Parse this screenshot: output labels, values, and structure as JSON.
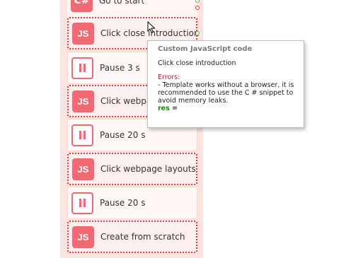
{
  "blocks": [
    {
      "type": "cs",
      "icon": "C#",
      "label": "Go to start"
    },
    {
      "type": "js",
      "icon": "JS",
      "label": "Click close introduction"
    },
    {
      "type": "pause",
      "label": "Pause 3 s"
    },
    {
      "type": "js",
      "icon": "JS",
      "label": "Click webpage layouts"
    },
    {
      "type": "pause",
      "label": "Pause 20 s"
    },
    {
      "type": "js",
      "icon": "JS",
      "label": "Click webpage layouts"
    },
    {
      "type": "pause",
      "label": "Pause 20 s"
    },
    {
      "type": "js",
      "icon": "JS",
      "label": "Create from scratch"
    }
  ],
  "tooltip": {
    "title": "Custom JavaScript code",
    "description": "Click close introduction",
    "errors_heading": "Errors:",
    "error_lines": [
      "- Template works without a browser, it is",
      "recommended to use the C # snippet to",
      "avoid memory leaks."
    ],
    "result_key": "res",
    "result_op": "="
  },
  "colors": {
    "lane": "#fde4e1",
    "accent": "#ef6a73",
    "error": "#c8102e",
    "result": "#118a11"
  }
}
